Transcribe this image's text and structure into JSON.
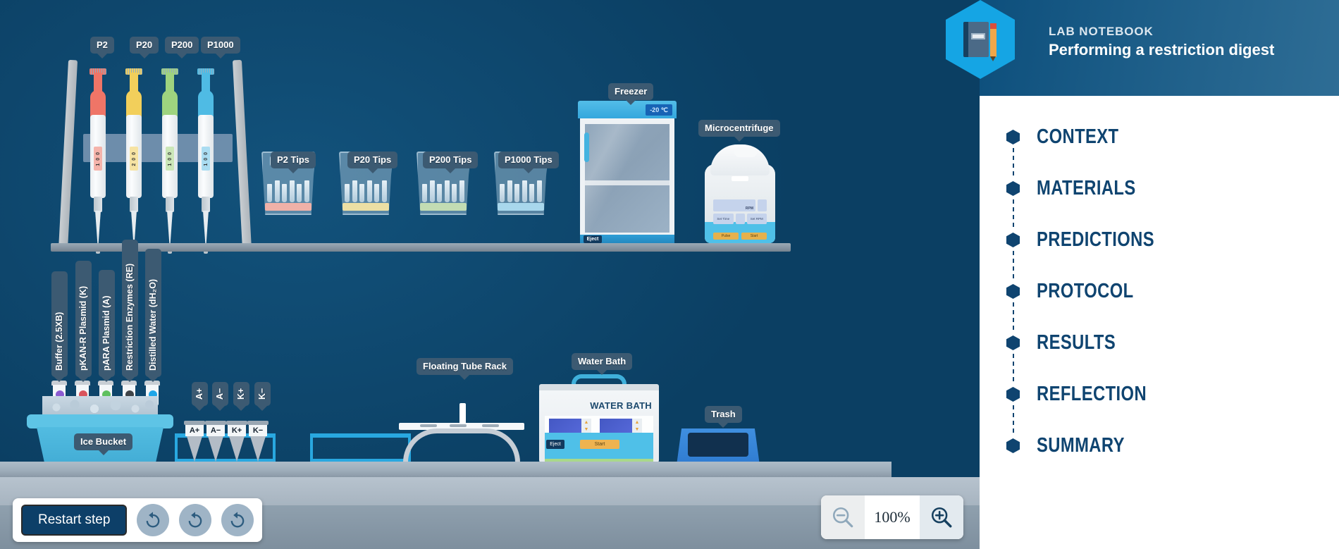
{
  "header": {
    "kicker": "LAB NOTEBOOK",
    "title": "Performing a restriction digest",
    "notebook_icon": "notebook-pencil-icon"
  },
  "sidebar": {
    "items": [
      {
        "label": "CONTEXT"
      },
      {
        "label": "MATERIALS"
      },
      {
        "label": "PREDICTIONS"
      },
      {
        "label": "PROTOCOL"
      },
      {
        "label": "RESULTS"
      },
      {
        "label": "REFLECTION"
      },
      {
        "label": "SUMMARY"
      }
    ]
  },
  "scene": {
    "pipettes": [
      {
        "label": "P2",
        "color": "#ef7567",
        "volume": "1 0 0"
      },
      {
        "label": "P20",
        "color": "#f2cf5b",
        "volume": "2 0 0"
      },
      {
        "label": "P200",
        "color": "#9ed37f",
        "volume": "1 0 0"
      },
      {
        "label": "P1000",
        "color": "#4fbbe4",
        "volume": "1 0 0"
      }
    ],
    "tipboxes": [
      {
        "label": "P2 Tips",
        "color": "#efb1a8"
      },
      {
        "label": "P20 Tips",
        "color": "#ecdfa4"
      },
      {
        "label": "P200 Tips",
        "color": "#c2dcb3"
      },
      {
        "label": "P1000 Tips",
        "color": "#a8d7ec"
      }
    ],
    "freezer": {
      "label": "Freezer",
      "temperature": "-20 ℃",
      "eject_label": "Eject"
    },
    "microcentrifuge": {
      "label": "Microcentrifuge",
      "rpm_label": "RPM",
      "set_speed_label": "Set Time",
      "set_time_label": "Set RPM",
      "pulse_label": "Pulse",
      "start_label": "Start"
    },
    "reagents": [
      {
        "label": "Buffer (2.5XB)",
        "color": "#8c5bd1"
      },
      {
        "label": "pKAN-R Plasmid (K)",
        "color": "#d9545c"
      },
      {
        "label": "pARA Plasmid (A)",
        "color": "#5fc05f"
      },
      {
        "label": "Restriction Enzymes (RE)",
        "color": "#3f4448"
      },
      {
        "label": "Distilled Water (dH₂O)",
        "color": "#1ea6e8"
      }
    ],
    "ice_bucket": {
      "label": "Ice Bucket"
    },
    "sample_tubes": [
      {
        "label": "A+"
      },
      {
        "label": "A−"
      },
      {
        "label": "K+"
      },
      {
        "label": "K−"
      }
    ],
    "floating_tube_rack": {
      "label": "Floating Tube Rack"
    },
    "water_bath": {
      "label": "Water Bath",
      "title": "WATER BATH",
      "start_label": "Start",
      "eject_label": "Eject"
    },
    "trash": {
      "label": "Trash"
    }
  },
  "controls": {
    "restart_label": "Restart step",
    "undo_buttons": [
      {
        "icon": "undo-icon"
      },
      {
        "icon": "undo-icon"
      },
      {
        "icon": "undo-icon"
      }
    ],
    "zoom": {
      "level": "100%",
      "zoom_out_icon": "magnifier-minus-icon",
      "zoom_in_icon": "magnifier-plus-icon"
    }
  }
}
